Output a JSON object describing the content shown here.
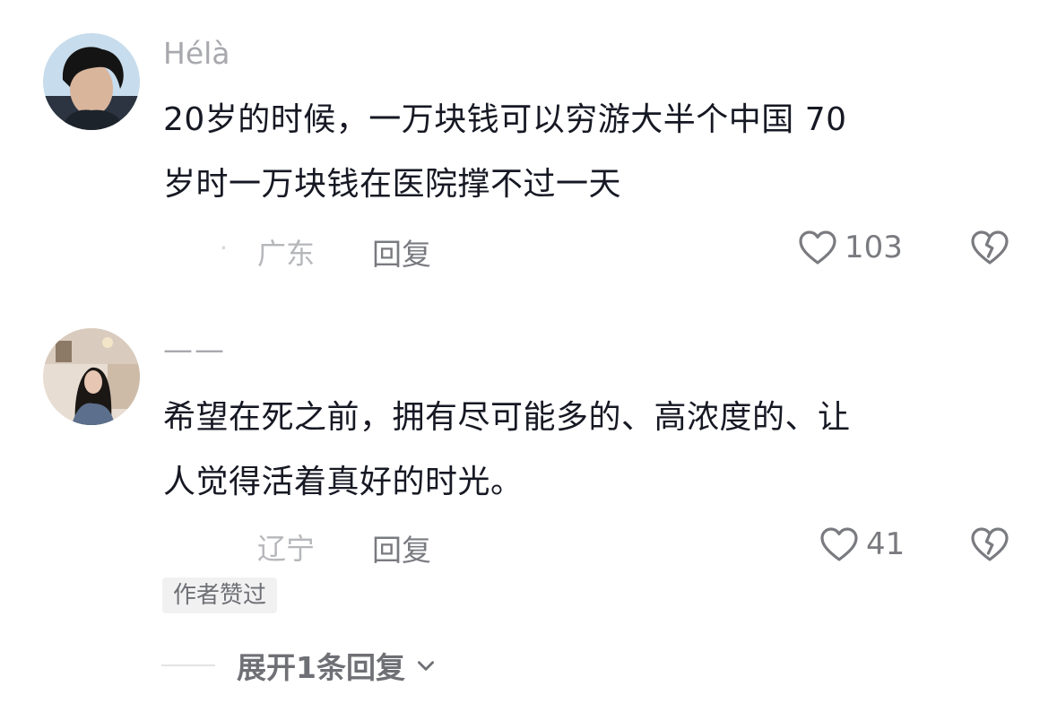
{
  "comments": [
    {
      "username": "Hélà",
      "lines": [
        "20岁的时候，一万块钱可以穷游大半个中国 70",
        "岁时一万块钱在医院撑不过一天"
      ],
      "location": "广东",
      "reply_label": "回复",
      "like_count": "103"
    },
    {
      "username": "——",
      "lines": [
        "希望在死之前，拥有尽可能多的、高浓度的、让",
        "人觉得活着真好的时光。"
      ],
      "location": "辽宁",
      "reply_label": "回复",
      "like_count": "41",
      "author_badge": "作者赞过",
      "expand_label": "展开1条回复"
    }
  ],
  "icons": {
    "like": "heart-outline-icon",
    "dislike": "broken-heart-icon",
    "expand": "chevron-down-icon"
  },
  "colors": {
    "text_primary": "#161823",
    "text_secondary": "#a8a9ae",
    "icon": "#7a7b80"
  }
}
